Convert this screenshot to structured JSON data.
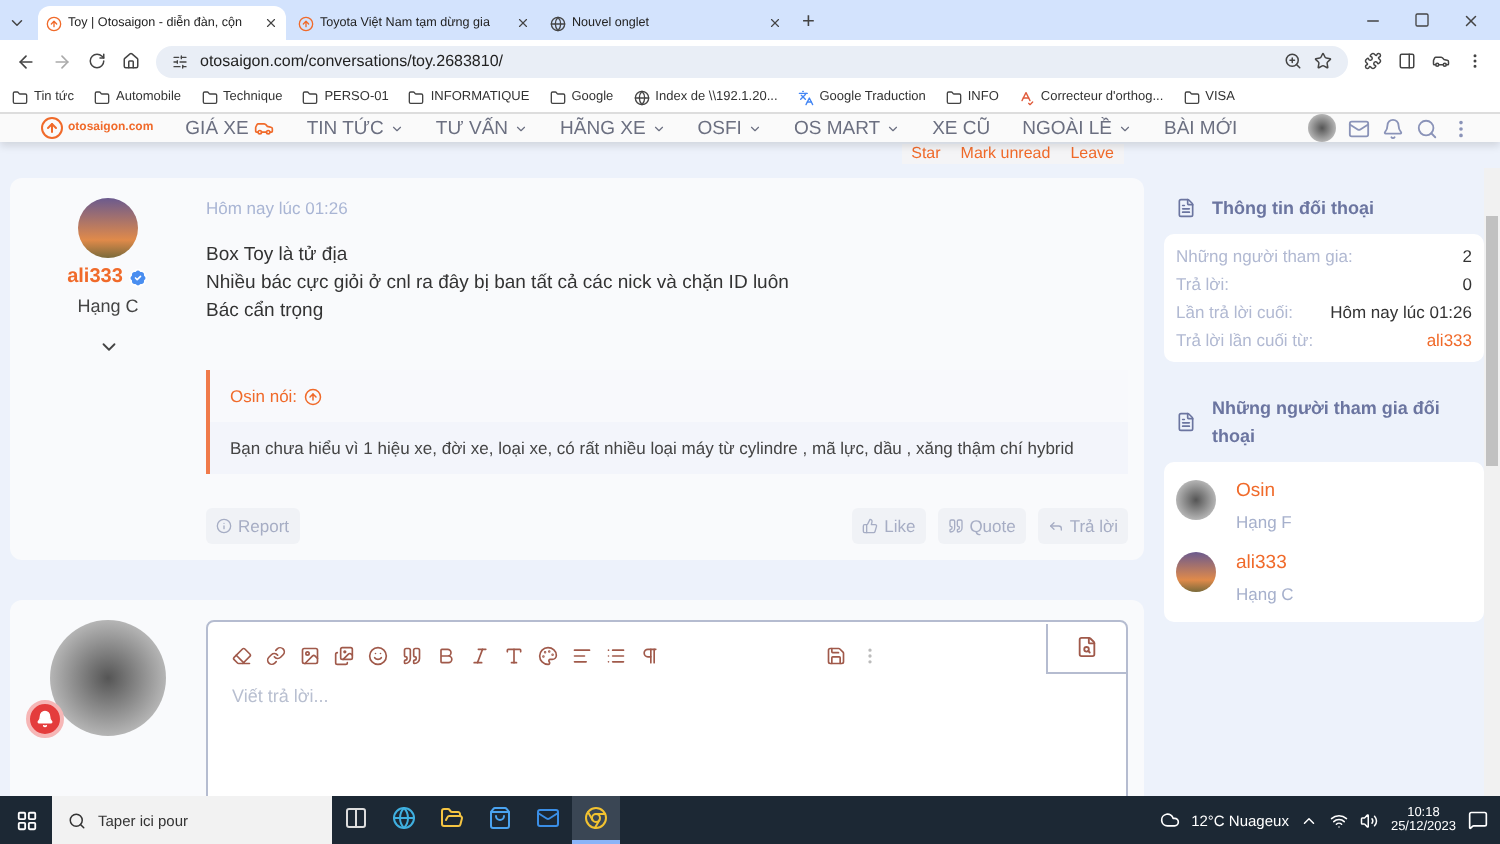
{
  "browser": {
    "tabs": [
      {
        "title": "Toy | Otosaigon - diễn đàn, cộn",
        "selected": true,
        "kind": "site"
      },
      {
        "title": "Toyota Việt Nam tạm dừng gia",
        "selected": false,
        "kind": "site"
      },
      {
        "title": "Nouvel onglet",
        "selected": false,
        "kind": "chrome"
      }
    ],
    "new_tab": "+",
    "address": "otosaigon.com/conversations/toy.2683810/",
    "bookmarks": [
      {
        "label": "Tin tức",
        "kind": "folder"
      },
      {
        "label": "Automobile",
        "kind": "folder"
      },
      {
        "label": "Technique",
        "kind": "folder"
      },
      {
        "label": "PERSO-01",
        "kind": "folder"
      },
      {
        "label": "INFORMATIQUE",
        "kind": "folder"
      },
      {
        "label": "Google",
        "kind": "folder"
      },
      {
        "label": "Index de \\\\192.1.20...",
        "kind": "globe"
      },
      {
        "label": "Google Traduction",
        "kind": "translate"
      },
      {
        "label": "INFO",
        "kind": "folder"
      },
      {
        "label": "Correcteur d'orthog...",
        "kind": "spell"
      },
      {
        "label": "VISA",
        "kind": "folder"
      }
    ]
  },
  "site": {
    "logo": "otosaigon.com",
    "nav": [
      {
        "label": "GIÁ XE",
        "dropdown": false,
        "car": true
      },
      {
        "label": "TIN TỨC",
        "dropdown": true,
        "car": false
      },
      {
        "label": "TƯ VẤN",
        "dropdown": true,
        "car": false
      },
      {
        "label": "HÃNG XE",
        "dropdown": true,
        "car": false
      },
      {
        "label": "OSFI",
        "dropdown": true,
        "car": false
      },
      {
        "label": "OS MART",
        "dropdown": true,
        "car": false
      },
      {
        "label": "XE CŨ",
        "dropdown": false,
        "car": false
      },
      {
        "label": "NGOÀI LỀ",
        "dropdown": true,
        "car": false
      },
      {
        "label": "BÀI MỚI",
        "dropdown": false,
        "car": false
      }
    ],
    "conversation_actions": [
      "Star",
      "Mark unread",
      "Leave"
    ]
  },
  "message": {
    "author": "ali333",
    "verified": true,
    "rank": "Hạng C",
    "time": "Hôm nay lúc 01:26",
    "lines": [
      "Box Toy là tử địa",
      "Nhiều bác cực giỏi ở cnl ra đây bị ban tất cả các nick và chặn ID luôn",
      "Bác cẩn trọng"
    ],
    "quote": {
      "author": "Osin nói:",
      "text": "Bạn chưa hiểu vì 1 hiệu xe, đời xe, loại xe, có rất nhiều loại máy từ cylindre , mã lực, dầu , xăng thậm chí hybrid"
    },
    "report": "Report",
    "actions": [
      {
        "label": "Like",
        "kind": "like"
      },
      {
        "label": "Quote",
        "kind": "quote"
      },
      {
        "label": "Trả lời",
        "kind": "reply"
      }
    ]
  },
  "reply": {
    "placeholder": "Viết trả lời..."
  },
  "sidebar": {
    "info_title": "Thông tin đối thoại",
    "info": [
      {
        "label": "Những người tham gia:",
        "value": "2",
        "kind": "text"
      },
      {
        "label": "Trả lời:",
        "value": "0",
        "kind": "text"
      },
      {
        "label": "Lần trả lời cuối:",
        "value": "Hôm nay lúc 01:26",
        "kind": "text"
      },
      {
        "label": "Trả lời lần cuối từ:",
        "value": "ali333",
        "kind": "user"
      }
    ],
    "participants_title": "Những người tham gia đối thoại",
    "participants": [
      {
        "name": "Osin",
        "rank": "Hạng F"
      },
      {
        "name": "ali333",
        "rank": "Hạng C"
      }
    ]
  },
  "taskbar": {
    "search": "Taper ici pour",
    "apps": [
      {
        "kind": "taskview",
        "selected": false
      },
      {
        "kind": "edge",
        "selected": false
      },
      {
        "kind": "files",
        "selected": false
      },
      {
        "kind": "store",
        "selected": false
      },
      {
        "kind": "mail",
        "selected": false
      },
      {
        "kind": "chrome",
        "selected": true
      }
    ],
    "weather": "12°C  Nuageux",
    "time": "10:18",
    "date": "25/12/2023"
  }
}
